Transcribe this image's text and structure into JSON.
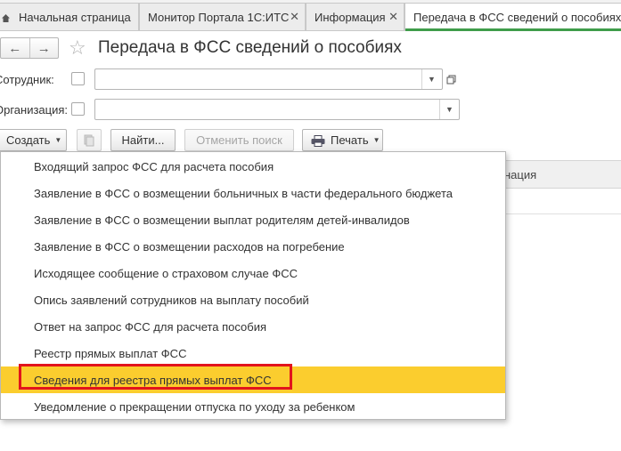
{
  "tabs": [
    {
      "label": "Начальная страница",
      "icon": "home-icon",
      "active": false
    },
    {
      "label": "Монитор Портала 1С:ИТС",
      "active": false
    },
    {
      "label": "Информация",
      "active": false
    },
    {
      "label": "Передача в ФСС сведений о пособиях",
      "active": true
    }
  ],
  "tab_close_glyph": "✕",
  "header": {
    "back_glyph": "←",
    "forward_glyph": "→",
    "star_glyph": "☆",
    "title": "Передача в ФСС сведений о пособиях"
  },
  "filters": {
    "employee_label": "Сотрудник:",
    "employee_value": "",
    "organization_label": "Организация:",
    "organization_value": ""
  },
  "toolbar": {
    "create_label": "Создать",
    "find_label": "Найти...",
    "cancel_search_label": "Отменить поиск",
    "print_label": "Печать"
  },
  "table": {
    "column_partial": "нация"
  },
  "menu": {
    "items": [
      "Входящий запрос ФСС для расчета пособия",
      "Заявление в ФСС о возмещении больничных в части федерального бюджета",
      "Заявление в ФСС о возмещении выплат родителям детей-инвалидов",
      "Заявление в ФСС о возмещении расходов на погребение",
      "Исходящее сообщение о страховом случае ФСС",
      "Опись заявлений сотрудников на выплату пособий",
      "Ответ на запрос ФСС для расчета пособия",
      "Реестр прямых выплат ФСС",
      "Сведения для реестра прямых выплат ФСС",
      "Уведомление о прекращении отпуска по уходу за ребенком"
    ],
    "selected_index": 8
  },
  "colors": {
    "active_tab_underline": "#3f9d4a",
    "selected_row": "#fbcd2e",
    "highlight_border": "#e2141c"
  }
}
